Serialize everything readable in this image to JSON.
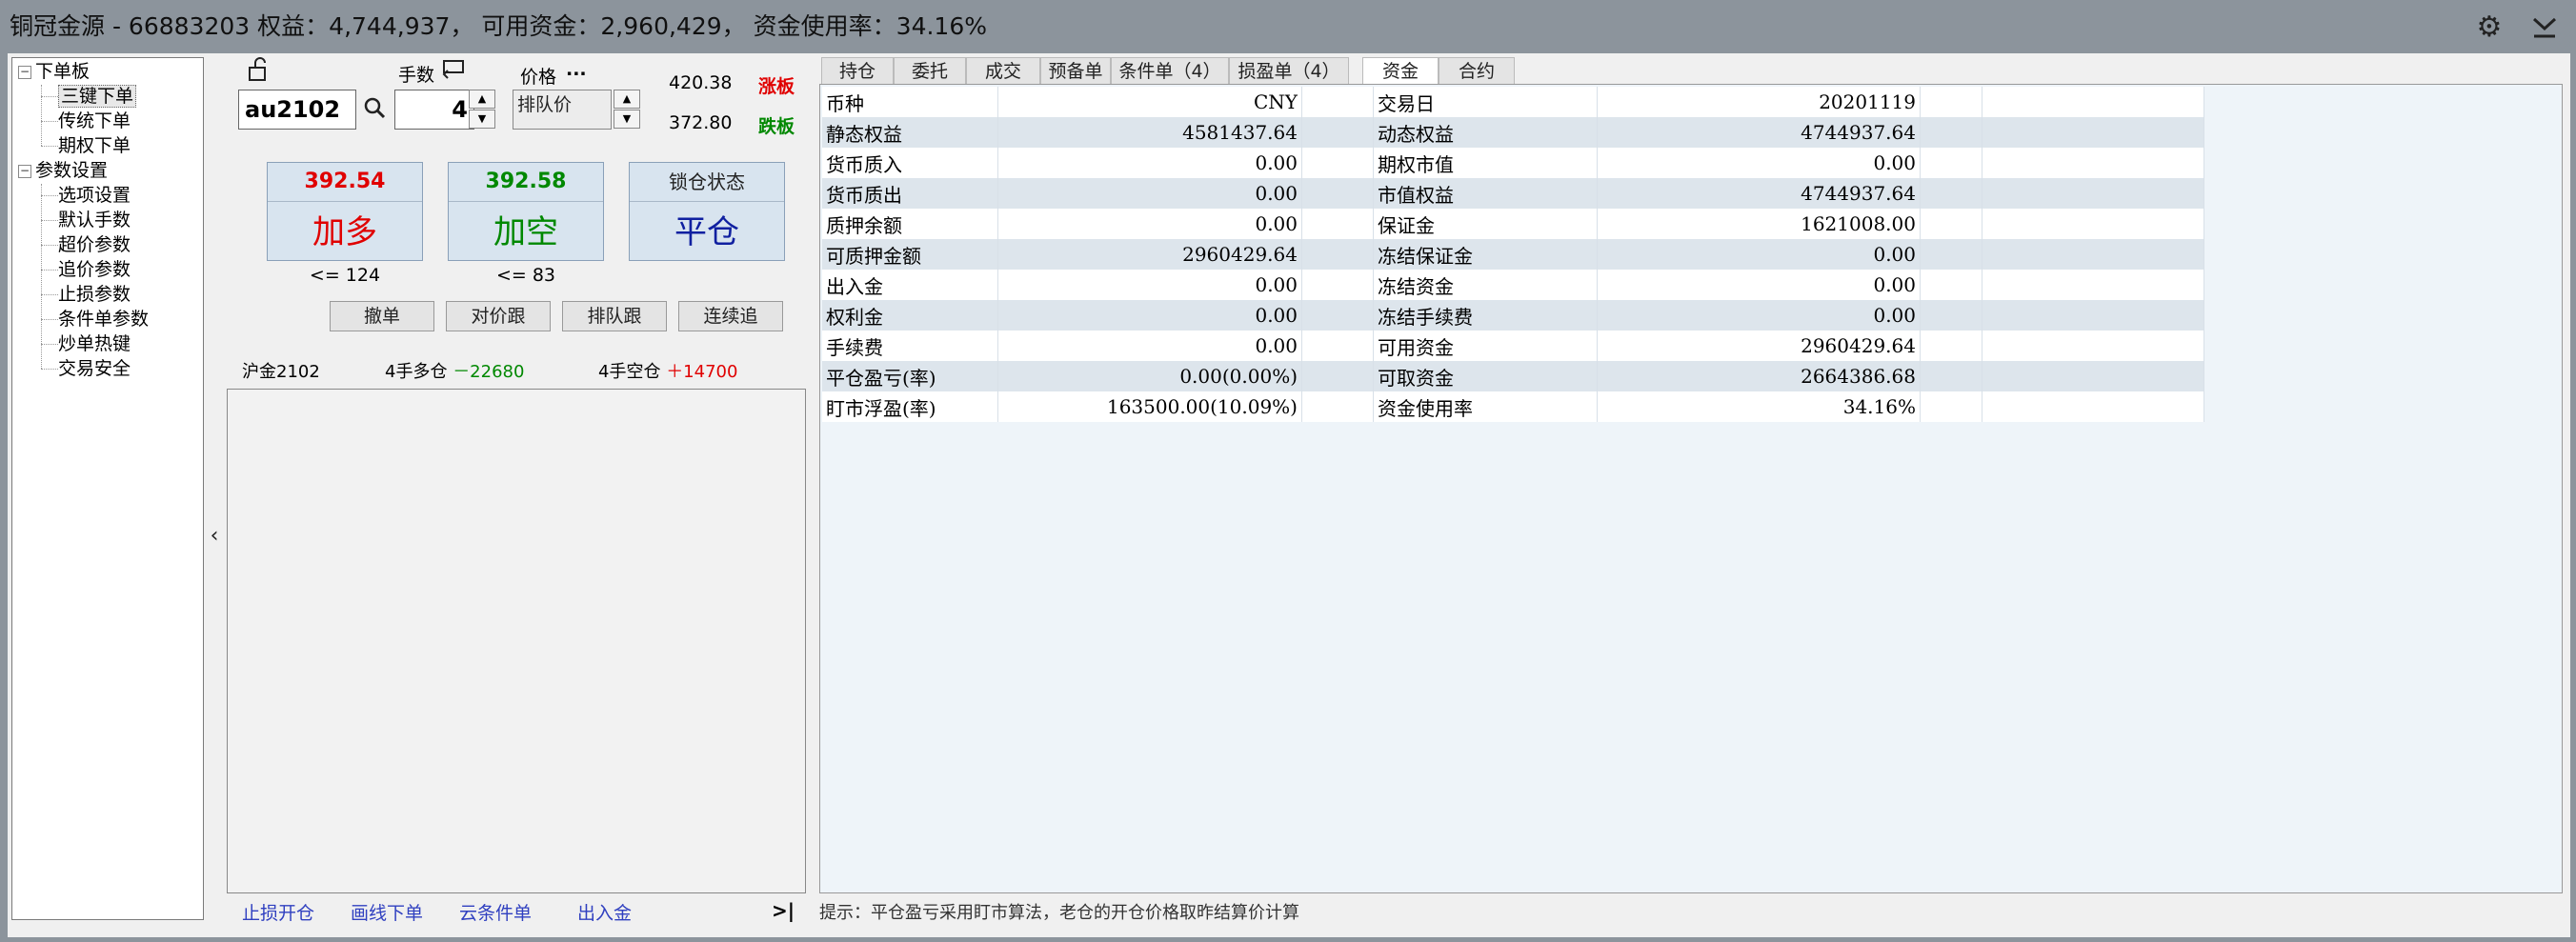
{
  "title": {
    "account": "铜冠金源 - 66883203",
    "equity": "权益：4,744,937，",
    "available": "可用资金：2,960,429，",
    "usage": "资金使用率：34.16%"
  },
  "icons": {
    "settings": "gear-icon",
    "dropdown": "chevron-down-icon",
    "lock": "lock-icon",
    "search": "search-icon",
    "swap": "swap-icon",
    "collapse": "chevron-left-icon",
    "expand": "chevron-right-end-icon"
  },
  "tree": {
    "groups": [
      {
        "label": "下单板",
        "items": [
          "三键下单",
          "传统下单",
          "期权下单"
        ]
      },
      {
        "label": "参数设置",
        "items": [
          "选项设置",
          "默认手数",
          "超价参数",
          "追价参数",
          "止损参数",
          "条件单参数",
          "炒单热键",
          "交易安全"
        ]
      }
    ]
  },
  "order": {
    "instrument": "au2102",
    "qty_label": "手数",
    "qty": "4",
    "price_label": "价格",
    "price_more": "...",
    "price_value": "排队价",
    "limit_up_price": "420.38",
    "limit_up_label": "涨板",
    "limit_down_price": "372.80",
    "limit_down_label": "跌板",
    "buy": {
      "price": "392.54",
      "label": "加多",
      "limit": "<= 124"
    },
    "sell": {
      "price": "392.58",
      "label": "加空",
      "limit": "<= 83"
    },
    "close": {
      "status": "锁仓状态",
      "label": "平仓"
    },
    "buttons": [
      "撤单",
      "对价跟",
      "排队跟",
      "连续追"
    ],
    "position": {
      "contract": "沪金2102",
      "long_qty": "4",
      "long_label": "手多仓",
      "long_pnl": "－22680",
      "short_qty": "4",
      "short_label": "手空仓",
      "short_pnl": "＋14700"
    },
    "bottom_links": [
      "止损开仓",
      "画线下单",
      "云条件单",
      "出入金"
    ]
  },
  "tabs": [
    "持仓",
    "委托",
    "成交",
    "预备单",
    "条件单（4）",
    "损盈单（4）",
    "资金",
    "合约"
  ],
  "active_tab": "资金",
  "funds": {
    "rows": [
      [
        "币种",
        "CNY",
        "交易日",
        "20201119"
      ],
      [
        "静态权益",
        "4581437.64",
        "动态权益",
        "4744937.64"
      ],
      [
        "货币质入",
        "0.00",
        "期权市值",
        "0.00"
      ],
      [
        "货币质出",
        "0.00",
        "市值权益",
        "4744937.64"
      ],
      [
        "质押余额",
        "0.00",
        "保证金",
        "1621008.00"
      ],
      [
        "可质押金额",
        "2960429.64",
        "冻结保证金",
        "0.00"
      ],
      [
        "出入金",
        "0.00",
        "冻结资金",
        "0.00"
      ],
      [
        "权利金",
        "0.00",
        "冻结手续费",
        "0.00"
      ],
      [
        "手续费",
        "0.00",
        "可用资金",
        "2960429.64"
      ],
      [
        "平仓盈亏(率)",
        "0.00(0.00%)",
        "可取资金",
        "2664386.68"
      ],
      [
        "盯市浮盈(率)",
        "163500.00(10.09%)",
        "资金使用率",
        "34.16%"
      ]
    ]
  },
  "hint": "提示：平仓盈亏采用盯市算法，老仓的开仓价格取昨结算价计算",
  "colors": {
    "up": "#e00000",
    "down": "#008800",
    "close": "#1020a0",
    "link": "#3040c0"
  }
}
